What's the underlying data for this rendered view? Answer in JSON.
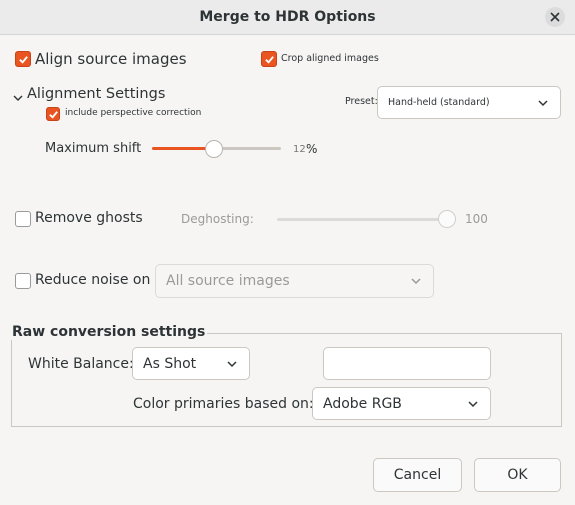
{
  "dialog": {
    "title": "Merge to HDR Options"
  },
  "align": {
    "label": "Align source images",
    "checked": true,
    "crop_label": "Crop aligned images",
    "crop_checked": true
  },
  "alignment": {
    "header": "Alignment Settings",
    "perspective_label": "include perspective correction",
    "perspective_checked": true,
    "preset_label": "Preset:",
    "preset_value": "Hand-held (standard)",
    "max_shift_label": "Maximum shift",
    "max_shift_value": "12",
    "max_shift_unit": "%",
    "max_shift_fraction": 0.48
  },
  "ghosts": {
    "label": "Remove ghosts",
    "checked": false,
    "deghosting_label": "Deghosting:",
    "deghosting_value": "100",
    "deghosting_fraction": 1.0
  },
  "noise": {
    "label": "Reduce noise on",
    "checked": false,
    "value": "All source images"
  },
  "raw": {
    "section_title": "Raw conversion settings",
    "white_balance_label": "White Balance:",
    "white_balance_value": "As Shot",
    "white_balance_extra": "",
    "color_primaries_label": "Color primaries based on:",
    "color_primaries_value": "Adobe RGB"
  },
  "buttons": {
    "cancel": "Cancel",
    "ok": "OK"
  },
  "colors": {
    "accent": "#e95420",
    "background": "#f6f5f4"
  },
  "icons": {
    "close": "close-icon",
    "check": "check-icon",
    "chevron_down": "chevron-down-icon",
    "expander": "expander-chevron-icon"
  }
}
